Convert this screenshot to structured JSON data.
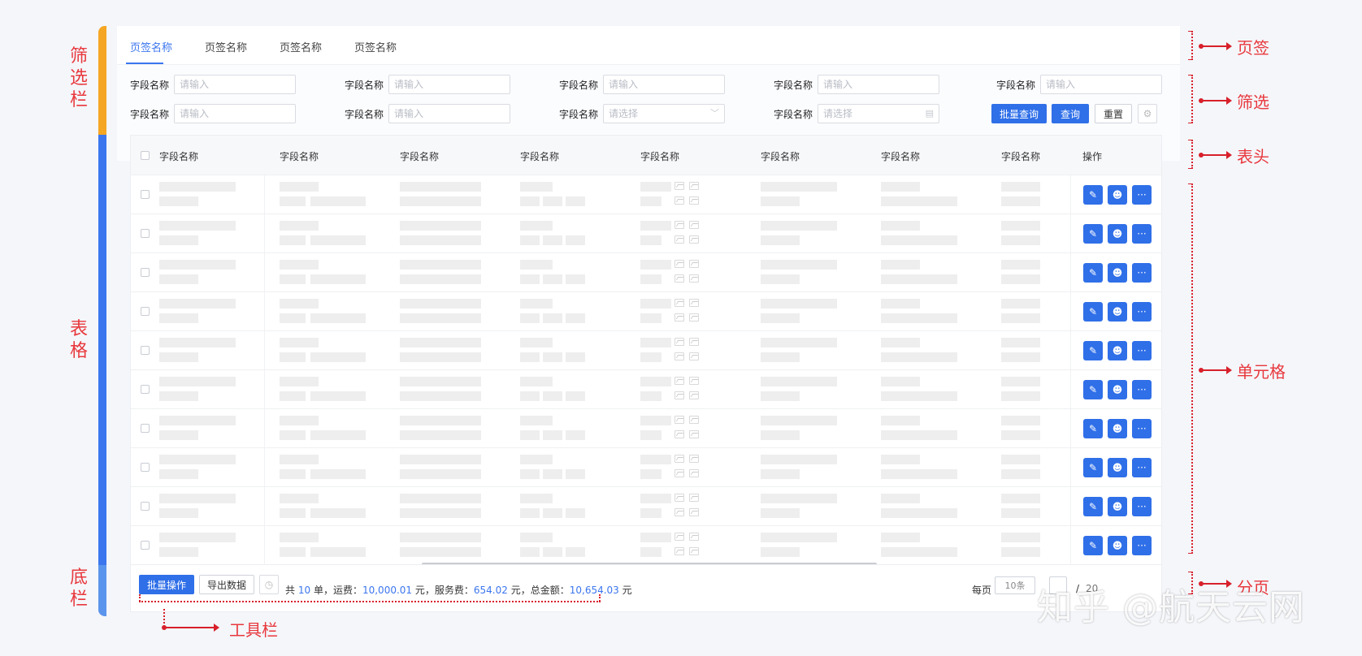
{
  "side_labels": {
    "filter": "筛选栏",
    "table": "表格",
    "footer": "底栏"
  },
  "tabs": [
    "页签名称",
    "页签名称",
    "页签名称",
    "页签名称"
  ],
  "filters": {
    "row1": [
      {
        "label": "字段名称",
        "placeholder": "请输入"
      },
      {
        "label": "字段名称",
        "placeholder": "请输入"
      },
      {
        "label": "字段名称",
        "placeholder": "请输入"
      },
      {
        "label": "字段名称",
        "placeholder": "请输入"
      },
      {
        "label": "字段名称",
        "placeholder": "请输入"
      }
    ],
    "row2": [
      {
        "label": "字段名称",
        "placeholder": "请输入"
      },
      {
        "label": "字段名称",
        "placeholder": "请输入"
      },
      {
        "label": "字段名称",
        "placeholder": "请选择"
      },
      {
        "label": "字段名称",
        "placeholder": "请选择"
      }
    ],
    "batch_query": "批量查询",
    "query": "查询",
    "reset": "重置"
  },
  "table": {
    "headers": [
      "字段名称",
      "字段名称",
      "字段名称",
      "字段名称",
      "字段名称",
      "字段名称",
      "字段名称",
      "字段名称",
      "操作"
    ],
    "row_count": 10,
    "action_icons": [
      "edit-icon",
      "user-icon",
      "more-icon"
    ]
  },
  "footer": {
    "batch_action": "批量操作",
    "export": "导出数据",
    "summary_prefix": "共",
    "order_count": "10",
    "order_unit": "单，运费：",
    "freight": "10,000.01",
    "freight_unit": "元，服务费：",
    "service_fee": "654.02",
    "service_unit": "元，总金额：",
    "total": "10,654.03",
    "total_unit": "元",
    "per_page_label": "每页",
    "per_page_value": "10条",
    "page_sep": "/",
    "total_pages": "20"
  },
  "annotations": {
    "tabs": "页签",
    "filter": "筛选",
    "header": "表头",
    "cells": "单元格",
    "pagination": "分页",
    "toolbar": "工具栏"
  },
  "watermark": "知乎 @航天云网",
  "colors": {
    "accent": "#2f6fe8",
    "annotation": "#e8383d",
    "filter_bar": "#f5a623",
    "table_bar": "#3b76ee"
  }
}
